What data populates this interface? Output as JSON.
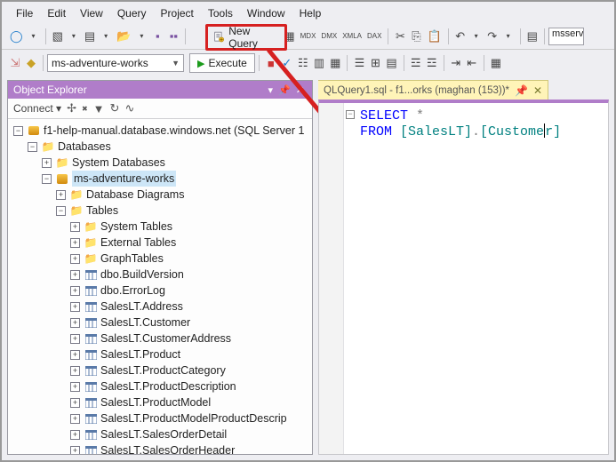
{
  "menu": {
    "items": [
      "File",
      "Edit",
      "View",
      "Query",
      "Project",
      "Tools",
      "Window",
      "Help"
    ]
  },
  "toolbar1": {
    "new_query_label": "New Query",
    "server_box_partial": "msservi"
  },
  "toolbar2": {
    "db_selected": "ms-adventure-works",
    "execute_label": "Execute"
  },
  "object_explorer": {
    "title": "Object Explorer",
    "connect_label": "Connect",
    "server_node": "f1-help-manual.database.windows.net (SQL Server 1",
    "nodes": {
      "databases": "Databases",
      "system_databases": "System Databases",
      "selected_db": "ms-adventure-works",
      "db_diagrams": "Database Diagrams",
      "tables": "Tables",
      "system_tables": "System Tables",
      "external_tables": "External Tables",
      "graph_tables": "GraphTables",
      "t0": "dbo.BuildVersion",
      "t1": "dbo.ErrorLog",
      "t2": "SalesLT.Address",
      "t3": "SalesLT.Customer",
      "t4": "SalesLT.CustomerAddress",
      "t5": "SalesLT.Product",
      "t6": "SalesLT.ProductCategory",
      "t7": "SalesLT.ProductDescription",
      "t8": "SalesLT.ProductModel",
      "t9": "SalesLT.ProductModelProductDescrip",
      "t10": "SalesLT.SalesOrderDetail",
      "t11": "SalesLT.SalesOrderHeader"
    }
  },
  "editor": {
    "tab_label": "QLQuery1.sql - f1...orks (maghan (153))*",
    "code": {
      "kw_select": "SELECT",
      "star_op": " *",
      "kw_from": "FROM ",
      "ident_schema": "[SalesLT]",
      "dot": ".",
      "ident_obj_prefix": "[Custome",
      "ident_obj_suffix": "r]"
    }
  }
}
